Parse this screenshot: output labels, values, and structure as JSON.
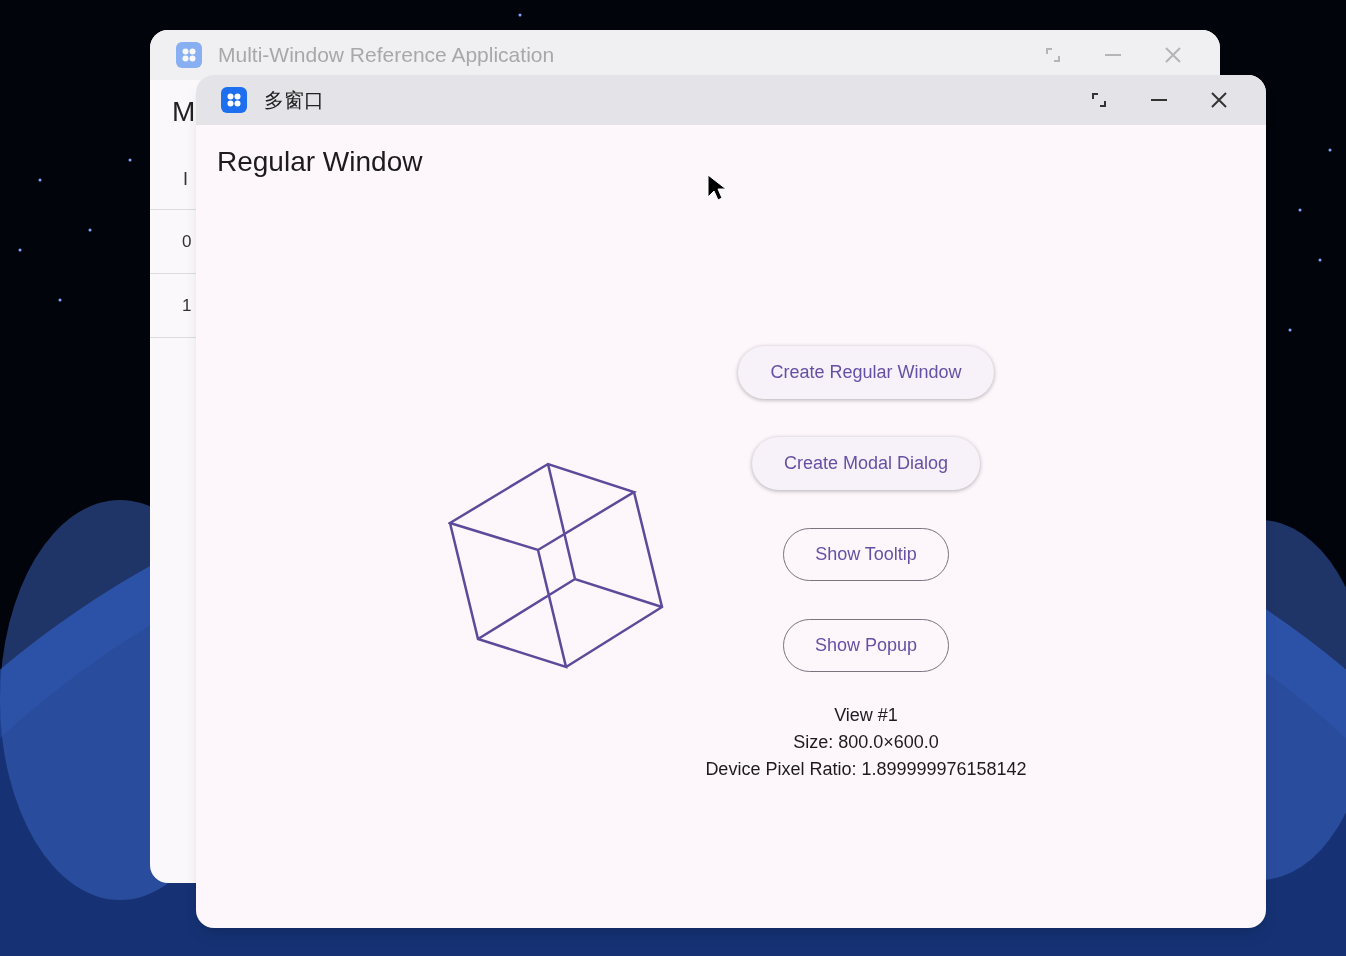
{
  "back_window": {
    "title": "Multi-Window Reference Application",
    "heading": "M",
    "table": {
      "header": "I",
      "rows": [
        "0",
        "1"
      ]
    }
  },
  "front_window": {
    "title": "多窗口",
    "heading": "Regular Window",
    "buttons": [
      {
        "label": "Create Regular Window",
        "kind": "elevated"
      },
      {
        "label": "Create Modal Dialog",
        "kind": "elevated"
      },
      {
        "label": "Show Tooltip",
        "kind": "outlined"
      },
      {
        "label": "Show Popup",
        "kind": "outlined"
      }
    ],
    "info": [
      "View #1",
      "Size: 800.0×600.0",
      "Device Pixel Ratio: 1.899999976158142"
    ]
  }
}
